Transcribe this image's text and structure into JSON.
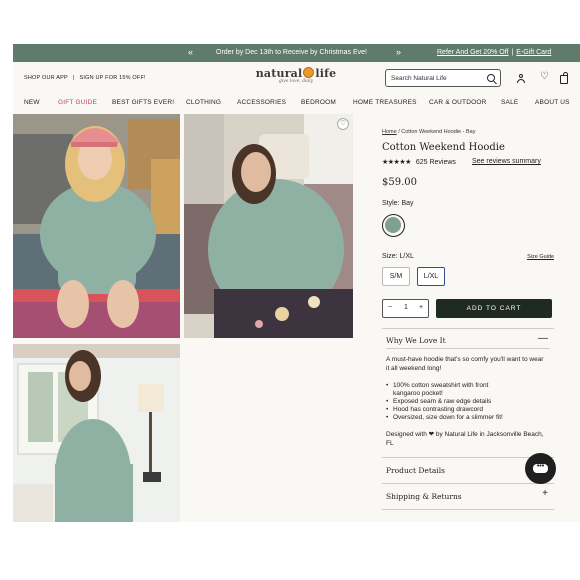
{
  "promo": {
    "message": "Order by Dec 13th to Receive by Christmas Eve!",
    "link_refer": "Refer And Get 20% Off",
    "link_gift": "E-Gift Card",
    "separator": "|"
  },
  "header": {
    "shop_app": "SHOP OUR APP",
    "signup": "SIGN UP FOR 15% OFF!",
    "bar": "|",
    "logo_left": "natural",
    "logo_right": "life",
    "logo_tagline": "give love, daily",
    "search_placeholder": "Search Natural Life"
  },
  "nav": {
    "items": [
      "NEW",
      "GIFT GUIDE",
      "BEST GIFTS EVER!",
      "CLOTHING",
      "ACCESSORIES",
      "BEDROOM",
      "HOME TREASURES",
      "CAR & OUTDOOR",
      "SALE",
      "ABOUT US"
    ]
  },
  "product": {
    "breadcrumb_home": "Home",
    "breadcrumb_sep": "/",
    "breadcrumb_current": "Cotton Weekend Hoodie - Bay",
    "title": "Cotton Weekend Hoodie",
    "stars": "★★★★★",
    "rating": 5,
    "review_count": "625 Reviews",
    "see_reviews": "See reviews summary",
    "price": "$59.00",
    "style_label": "Style: Bay",
    "swatch_color": "#7fa195",
    "size_label": "Size: L/XL",
    "size_guide": "Size Guide",
    "sizes": [
      "S/M",
      "L/XL"
    ],
    "selected_size": "L/XL",
    "qty_minus": "−",
    "qty_value": "1",
    "qty_plus": "+",
    "add_to_cart": "ADD TO CART"
  },
  "details": {
    "why_title": "Why We Love It",
    "why_sign": "—",
    "description": "A must-have hoodie that's so comfy you'll want to wear it all weekend long!",
    "bullets": [
      "100% cotton sweatshirt with front kangaroo pocket!",
      "Exposed seam & raw edge details",
      "Hood has contrasting drawcord",
      "Oversized, size down for a slimmer fit!"
    ],
    "designed": "Designed with ❤ by Natural Life in Jacksonville Beach, FL",
    "product_details": "Product Details",
    "shipping": "Shipping & Returns",
    "plus": "+"
  },
  "gallery": {
    "zoom_symbol": "♡"
  },
  "chat": {
    "dots": "•••"
  },
  "colors": {
    "promo_bg": "#5e7b6b",
    "gift_guide": "#c33e60",
    "cart_button": "#1f2a22",
    "hoodie": "#8fb1a4"
  }
}
